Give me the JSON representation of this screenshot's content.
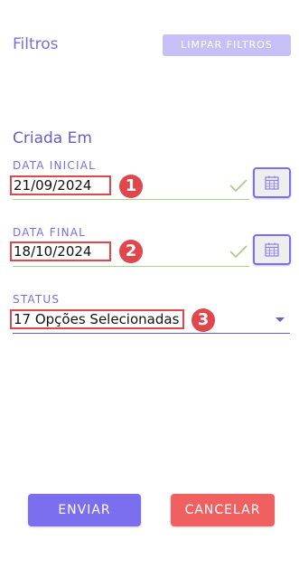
{
  "header": {
    "title": "Filtros",
    "clear_label": "LIMPAR FILTROS"
  },
  "section": {
    "title": "Criada Em"
  },
  "fields": {
    "start_date": {
      "label": "DATA INICIAL",
      "value": "21/09/2024",
      "badge": "1"
    },
    "end_date": {
      "label": "DATA FINAL",
      "value": "18/10/2024",
      "badge": "2"
    },
    "status": {
      "label": "STATUS",
      "value": "17 Opções Selecionadas",
      "badge": "3"
    }
  },
  "footer": {
    "submit_label": "ENVIAR",
    "cancel_label": "CANCELAR"
  },
  "colors": {
    "accent": "#7b6ff0",
    "danger": "#f16060",
    "annotation": "#e0474c",
    "valid": "#a9cf8a"
  },
  "icons": [
    "check-icon",
    "calendar-icon",
    "dropdown-caret-icon"
  ]
}
